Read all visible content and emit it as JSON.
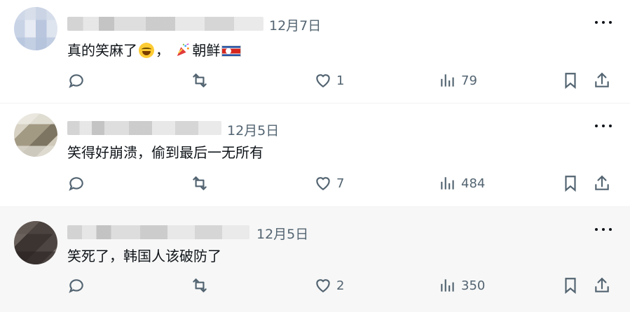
{
  "replies": [
    {
      "avatar": "avatar-1",
      "date": "12月7日",
      "text_parts": [
        "真的笑麻了",
        "，",
        "朝鲜"
      ],
      "emojis": [
        "laughing-crying-emoji",
        "party-popper-emoji",
        "north-korea-flag-emoji"
      ],
      "actions": {
        "replies": "",
        "retweets": "",
        "likes": "1",
        "views": "79"
      }
    },
    {
      "avatar": "avatar-2",
      "date": "12月5日",
      "text": "笑得好崩溃，偷到最后一无所有",
      "actions": {
        "replies": "",
        "retweets": "",
        "likes": "7",
        "views": "484"
      }
    },
    {
      "avatar": "avatar-3",
      "date": "12月5日",
      "text": "笑死了，韩国人该破防了",
      "actions": {
        "replies": "",
        "retweets": "",
        "likes": "2",
        "views": "350"
      }
    }
  ],
  "icons": {
    "reply": "reply-icon",
    "retweet": "retweet-icon",
    "like": "heart-icon",
    "views": "views-icon",
    "bookmark": "bookmark-icon",
    "share": "share-icon",
    "more": "more-icon"
  },
  "colors": {
    "text": "#0f1419",
    "secondary": "#536471",
    "divider": "#eff3f4",
    "hover_row": "#f7f7f7"
  }
}
